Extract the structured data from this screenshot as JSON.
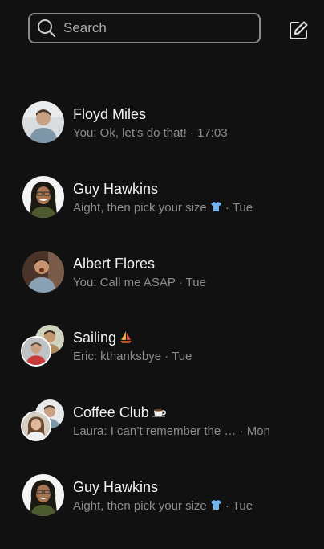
{
  "search": {
    "placeholder": "Search",
    "icon": "search-icon"
  },
  "compose": {
    "icon": "compose-icon"
  },
  "conversations": [
    {
      "title": "Floyd Miles",
      "preview": "You: Ok, let’s do that! · 17:03",
      "avatar": "person-avatar"
    },
    {
      "title": "Guy Hawkins",
      "preview": "Aight, then pick your size",
      "preview_suffix": " · Tue",
      "emoji": "shirt-emoji",
      "avatar": "person-avatar"
    },
    {
      "title": "Albert Flores",
      "preview": "You: Call me ASAP · Tue",
      "avatar": "person-avatar"
    },
    {
      "title": "Sailing",
      "title_emoji": "sailboat-emoji",
      "preview": "Eric: kthanksbye · Tue",
      "avatar": "group-avatar"
    },
    {
      "title": "Coffee Club",
      "title_emoji": "coffee-emoji",
      "preview": "Laura: I can’t remember the … · Mon",
      "avatar": "group-avatar"
    },
    {
      "title": "Guy Hawkins",
      "preview": "Aight, then pick your size",
      "preview_suffix": " · Tue",
      "emoji": "shirt-emoji",
      "avatar": "person-avatar"
    }
  ],
  "colors": {
    "background": "#111111",
    "title": "#f2f2f2",
    "preview": "#8d8d8d",
    "search_border": "#8a8a8a"
  }
}
